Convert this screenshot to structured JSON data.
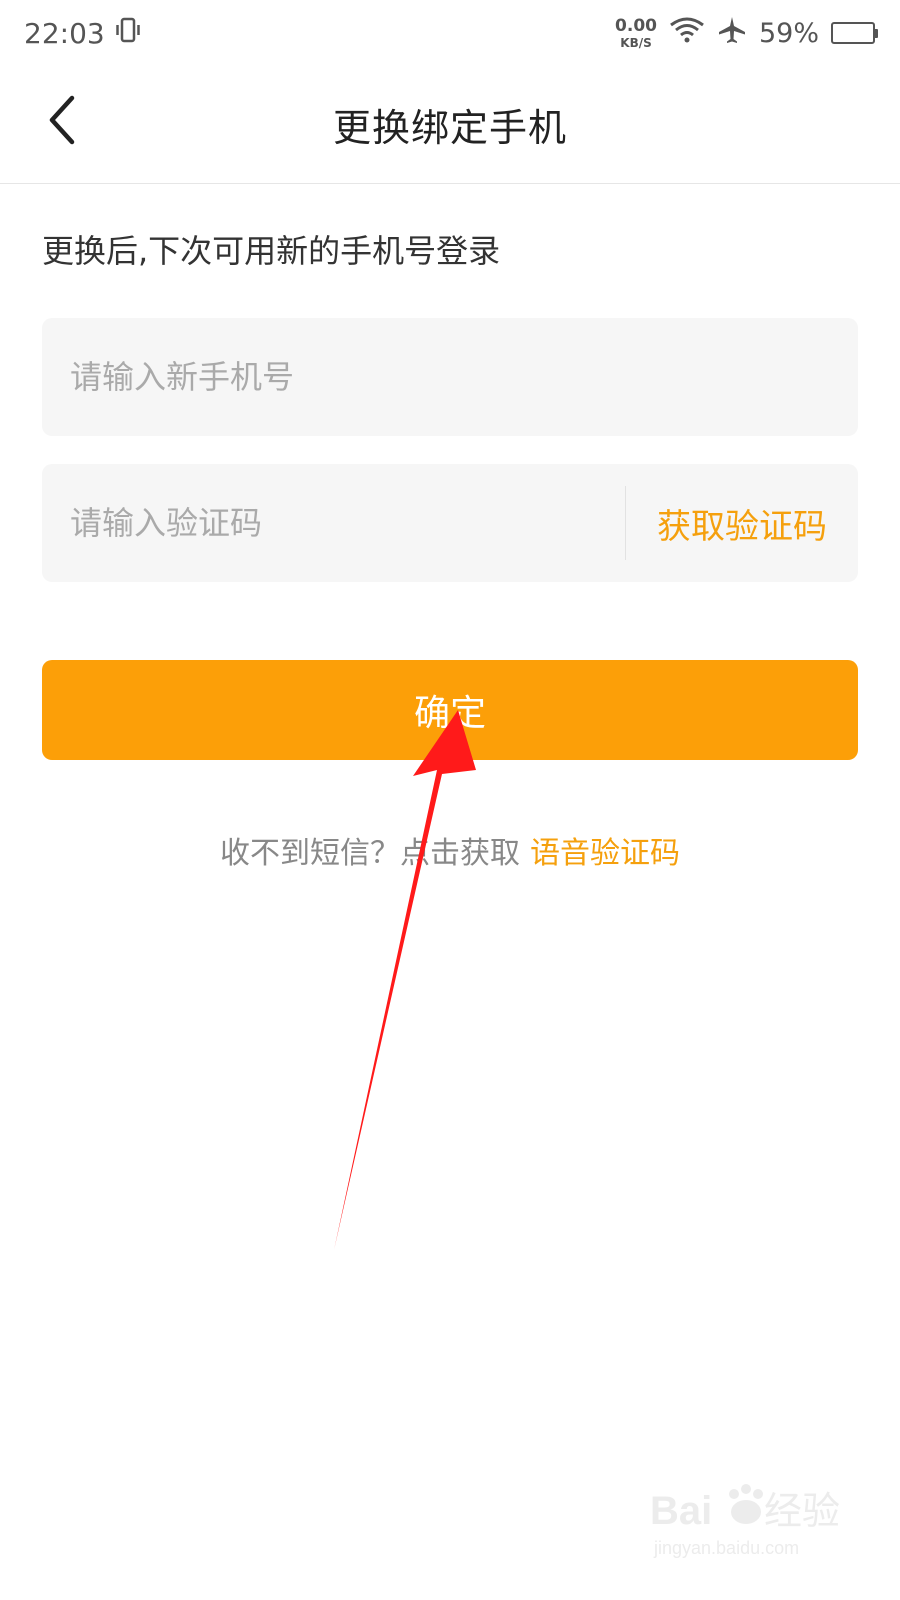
{
  "status_bar": {
    "time": "22:03",
    "net_speed_value": "0.00",
    "net_speed_unit": "KB/S",
    "battery_percent": "59%",
    "battery_level": 0.59,
    "icons": [
      "vibrate-icon",
      "wifi-icon",
      "airplane-icon",
      "battery-icon"
    ]
  },
  "header": {
    "title": "更换绑定手机",
    "back_icon": "chevron-left-icon"
  },
  "form": {
    "hint": "更换后,下次可用新的手机号登录",
    "phone_placeholder": "请输入新手机号",
    "code_placeholder": "请输入验证码",
    "get_code_label": "获取验证码",
    "confirm_label": "确定"
  },
  "footer_tip": {
    "text": "收不到短信？点击获取",
    "link_label": "语音验证码"
  },
  "annotation": {
    "type": "red-arrow",
    "color": "#ff1a1a"
  },
  "watermark": {
    "brand": "Baidu经验",
    "url": "jingyan.baidu.com"
  },
  "colors": {
    "accent": "#fc9f08",
    "link": "#f5a00d",
    "field_bg": "#f6f6f6",
    "placeholder": "#aaaaaa"
  }
}
